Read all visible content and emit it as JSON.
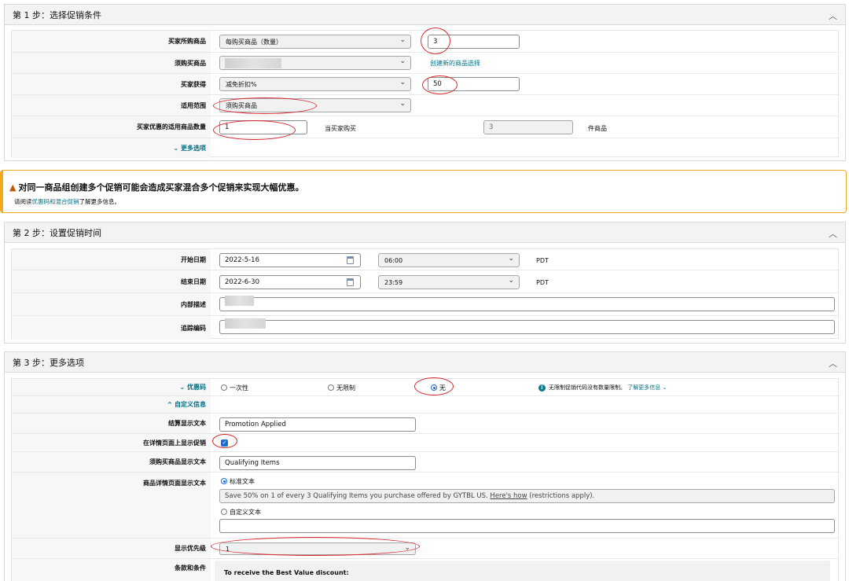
{
  "step1": {
    "title": "第 1 步：选择促销条件",
    "rows": {
      "buyer_purchases_label": "买家所购商品",
      "buyer_purchases_value": "每购买商品（数量）",
      "buyer_purchases_qty": "3",
      "required_label": "须购买商品",
      "create_selection_link": "创建新的商品选择",
      "buyer_gets_label": "买家获得",
      "buyer_gets_value": "减免折扣%",
      "buyer_gets_amount": "50",
      "scope_label": "适用范围",
      "scope_value": "须购买商品",
      "discount_qty_label": "买家优惠的适用商品数量",
      "discount_qty_value": "1",
      "when_buy_text": "当买家购买",
      "when_buy_value": "3",
      "items_text": "件商品",
      "more_options_link": "更多选项"
    }
  },
  "warning": {
    "title": "对同一商品组创建多个促销可能会造成买家混合多个促销来实现大幅优惠。",
    "sub_prefix": "请阅读",
    "sub_link": "优惠码和混合促销",
    "sub_suffix": "了解更多信息。"
  },
  "step2": {
    "title": "第 2 步：设置促销时间",
    "start_label": "开始日期",
    "start_date": "2022-5-16",
    "start_time": "06:00",
    "start_tz": "PDT",
    "end_label": "结束日期",
    "end_date": "2022-6-30",
    "end_time": "23:59",
    "end_tz": "PDT",
    "internal_desc_label": "内部描述",
    "tracking_label": "追踪编码"
  },
  "step3": {
    "title": "第 3 步：更多选项",
    "coupon_label": "优惠码",
    "coupon_opt1": "一次性",
    "coupon_opt2": "无限制",
    "coupon_opt3": "无",
    "coupon_info": "无限制促销代码没有数量限制。",
    "coupon_info_link": "了解更多信息",
    "custom_info_link": "自定义信息",
    "checkout_text_label": "结算显示文本",
    "checkout_text_value": "Promotion Applied",
    "show_on_detail_label": "在详情页面上显示促销",
    "qualifying_label": "须购买商品显示文本",
    "qualifying_value": "Qualifying Items",
    "detail_text_label": "商品详情页面显示文本",
    "standard_text": "标准文本",
    "standard_text_value_prefix": "Save 50% on 1 of every 3 Qualifying Items you purchase offered by GYTBL US.",
    "standard_text_link": "Here's how",
    "standard_text_suffix": "(restrictions apply).",
    "custom_text": "自定义文本",
    "priority_label": "显示优先级",
    "priority_value": "1",
    "terms_label": "条款和条件",
    "terms_value": "To receive the Best Value discount:"
  },
  "icons": {
    "chevron_up": "chevron-up-icon",
    "chevron_down": "chevron-down-icon",
    "warning": "warning-icon",
    "calendar": "calendar-icon",
    "info": "info-icon"
  },
  "colors": {
    "link": "#007185",
    "warning_border": "#f0a81d",
    "annotation": "#d9262c",
    "radio_selected": "#1a6bd6"
  }
}
